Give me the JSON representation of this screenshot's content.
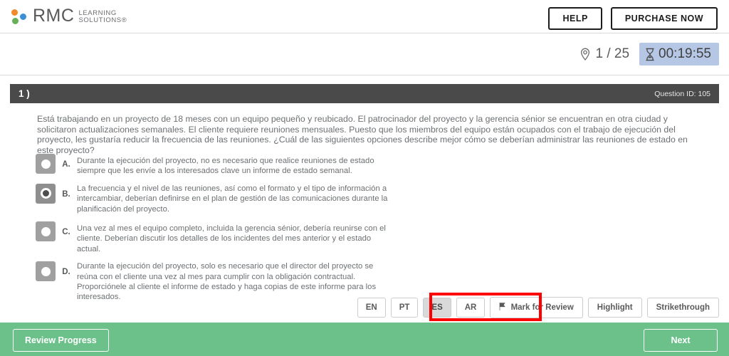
{
  "header": {
    "logo": {
      "brand": "RMC",
      "sub_line1": "LEARNING",
      "sub_line2": "SOLUTIONS®",
      "dot_orange": "#f08a2a",
      "dot_blue": "#3b8fd4",
      "dot_green": "#67b05a"
    },
    "help_label": "HELP",
    "purchase_label": "PURCHASE NOW"
  },
  "status": {
    "question_counter": "1 / 25",
    "timer": "00:19:55",
    "timer_bg": "#b6c7e6",
    "pin_icon": "location-pin-icon",
    "hourglass_icon": "hourglass-icon"
  },
  "question": {
    "number_label": "1 )",
    "id_label": "Question ID: 105",
    "text": "Está trabajando en un proyecto de 18 meses con un equipo pequeño y reubicado. El patrocinador del proyecto y la gerencia sénior se encuentran en otra ciudad y solicitaron actualizaciones semanales. El cliente requiere reuniones mensuales. Puesto que los miembros del equipo están ocupados con el trabajo de ejecución del proyecto, les gustaría reducir la frecuencia de las reuniones. ¿Cuál de las siguientes opciones describe mejor cómo se deberían administrar las reuniones de estado en este proyecto?",
    "options": [
      {
        "letter": "A.",
        "text": "Durante la ejecución del proyecto, no es necesario que realice reuniones de estado siempre que les envíe a los interesados clave un informe de estado semanal.",
        "selected": false
      },
      {
        "letter": "B.",
        "text": "La frecuencia y el nivel de las reuniones, así como el formato y el tipo de información a intercambiar, deberían definirse en el plan de gestión de las comunicaciones durante la planificación del proyecto.",
        "selected": true
      },
      {
        "letter": "C.",
        "text": "Una vez al mes el equipo completo, incluida la gerencia sénior, debería reunirse con el cliente. Deberían discutir los detalles de los incidentes del mes anterior y el estado actual.",
        "selected": false
      },
      {
        "letter": "D.",
        "text": "Durante la ejecución del proyecto, solo es necesario que el director del proyecto se reúna con el cliente una vez al mes para cumplir con la obligación contractual. Proporciónele al cliente el informe de estado y haga copias de este informe para los interesados.",
        "selected": false
      }
    ]
  },
  "toolbar": {
    "languages": [
      {
        "code": "EN",
        "active": false
      },
      {
        "code": "PT",
        "active": false
      },
      {
        "code": "ES",
        "active": true
      },
      {
        "code": "AR",
        "active": false
      }
    ],
    "mark_for_review_label": "Mark for Review",
    "highlight_label": "Highlight",
    "strikethrough_label": "Strikethrough",
    "annotation_color": "#ff0000"
  },
  "footer": {
    "review_progress_label": "Review Progress",
    "next_label": "Next",
    "bg_color": "#6cc08a"
  }
}
